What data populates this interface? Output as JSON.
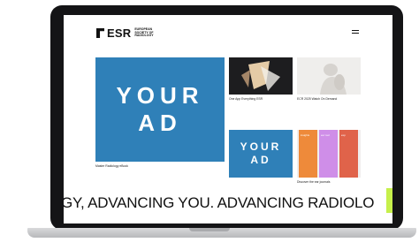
{
  "site": {
    "logo_text": "ESR",
    "logo_subtext": "EUROPEAN SOCIETY OF RADIOLOGY"
  },
  "cards": {
    "ad_large": "YOUR\nAD",
    "ad_large_caption": "Master Radiology eBook",
    "event_caption": "One App Everything ESR",
    "ecr_caption": "ECR 2025 Watch On Demand",
    "ad_small": "YOUR\nAD",
    "journals_caption": "Discover the ear journals",
    "journal_1": "insights",
    "journal_2": "eur rad",
    "journal_3": "exp"
  },
  "ticker": {
    "text": "GY, ADVANCING YOU. ADVANCING RADIOLO"
  },
  "colors": {
    "ad_blue": "#2f80b8",
    "ticker_accent": "#c6f04b",
    "journal_orange": "#ee8a3a",
    "journal_purple": "#cf8ee8",
    "journal_red": "#e0634a"
  }
}
